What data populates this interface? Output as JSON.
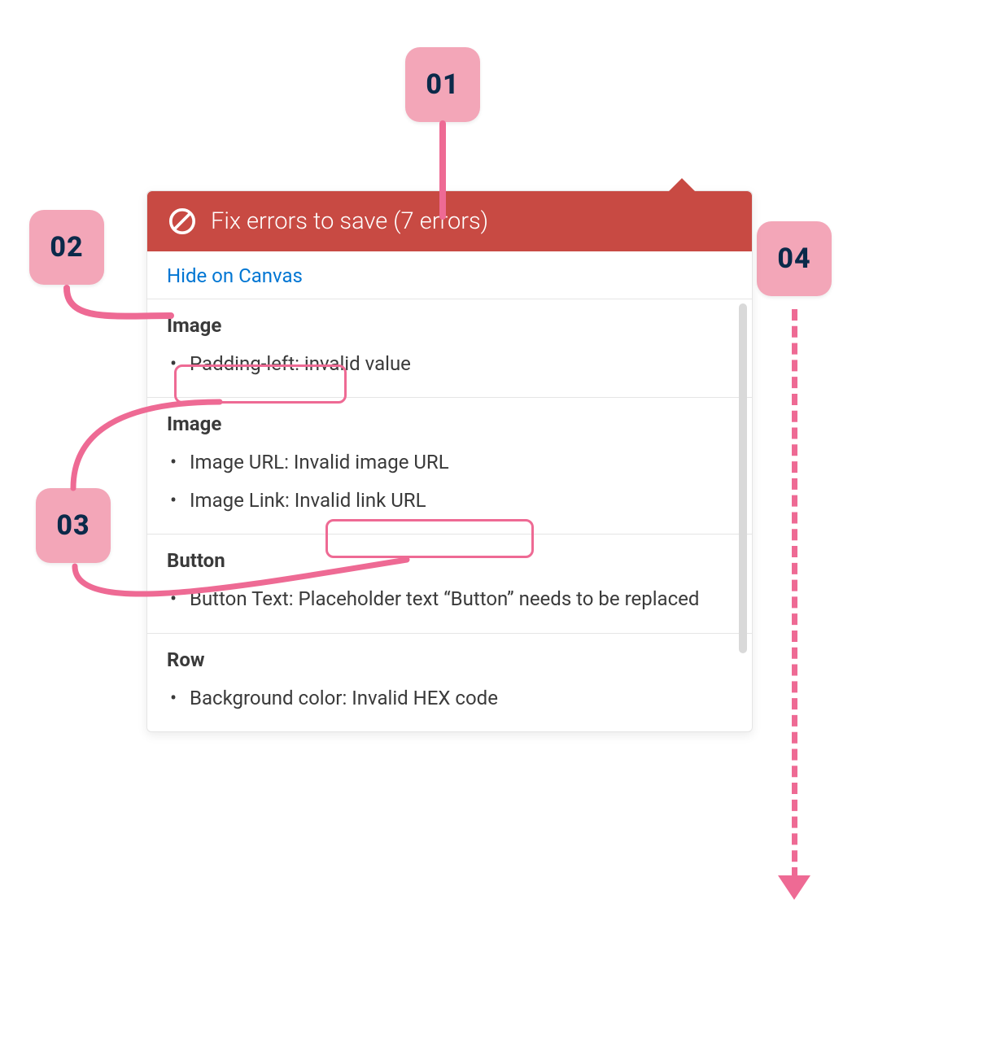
{
  "callouts": {
    "c1": "01",
    "c2": "02",
    "c3": "03",
    "c4": "04"
  },
  "panel": {
    "header_title": "Fix errors to save (7 errors)",
    "hide_link": "Hide on Canvas",
    "groups": [
      {
        "title": "Image",
        "items": [
          "Padding-left: invalid value"
        ]
      },
      {
        "title": "Image",
        "items": [
          "Image URL: Invalid image URL",
          "Image Link: Invalid link URL"
        ]
      },
      {
        "title": "Button",
        "items": [
          "Button Text: Placeholder text “Button” needs to be replaced"
        ]
      },
      {
        "title": "Row",
        "items": [
          "Background color: Invalid HEX code"
        ]
      }
    ]
  }
}
